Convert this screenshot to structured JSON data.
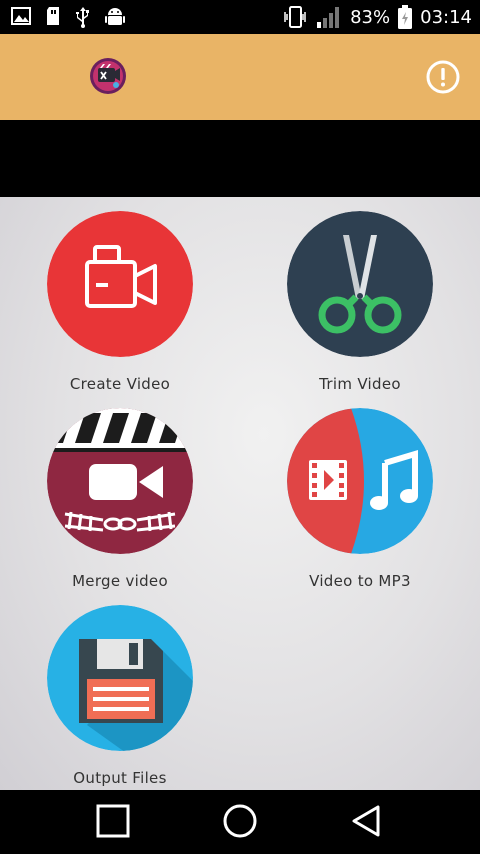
{
  "status_bar": {
    "battery_percent": "83%",
    "time": "03:14",
    "left_icons": [
      "image-icon",
      "sd-card-icon",
      "usb-icon",
      "android-icon"
    ],
    "right_icons": [
      "phone-vibrate-icon",
      "signal-icon",
      "battery-icon"
    ]
  },
  "app_bar": {
    "logo_icon": "app-logo-icon",
    "info_icon": "info-icon",
    "color": "#e9b466"
  },
  "tiles": [
    {
      "label": "Create Video",
      "icon": "video-camera-icon",
      "color": "#e83537"
    },
    {
      "label": "Trim Video",
      "icon": "scissors-icon",
      "color": "#2e4051"
    },
    {
      "label": "Merge video",
      "icon": "clapperboard-icon",
      "color": "#8f2741"
    },
    {
      "label": "Video to MP3",
      "icon": "film-music-icon",
      "color": "#e04545"
    },
    {
      "label": "Output Files",
      "icon": "floppy-disk-icon",
      "color": "#27b1e5"
    }
  ],
  "nav_bar": {
    "icons": [
      "recent-apps-icon",
      "home-icon",
      "back-icon"
    ]
  }
}
